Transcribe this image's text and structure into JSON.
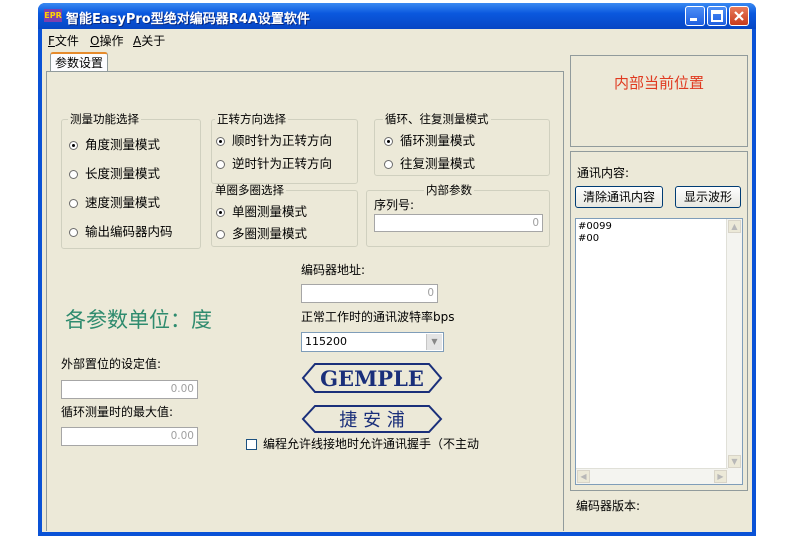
{
  "window": {
    "title": "智能EasyPro型绝对编码器R4A设置软件",
    "icon_text": "EPR",
    "icon": "app-logo-icon",
    "controls": [
      "minimize-icon",
      "maximize-icon",
      "close-icon"
    ]
  },
  "menu": [
    {
      "key": "F",
      "label": "文件"
    },
    {
      "key": "O",
      "label": "操作"
    },
    {
      "key": "A",
      "label": "关于"
    }
  ],
  "tab": {
    "label": "参数设置"
  },
  "groups": {
    "measure_mode": {
      "legend": "测量功能选择",
      "options": [
        "角度测量模式",
        "长度测量模式",
        "速度测量模式",
        "输出编码器内码"
      ],
      "selected": 0
    },
    "direction": {
      "legend": "正转方向选择",
      "options": [
        "顺时针为正转方向",
        "逆时针为正转方向"
      ],
      "selected": 0
    },
    "cycle_mode": {
      "legend": "循环、往复测量模式",
      "options": [
        "循环测量模式",
        "往复测量模式"
      ],
      "selected": 0
    },
    "turn_mode": {
      "legend": "单圈多圈选择",
      "options": [
        "单圈测量模式",
        "多圈测量模式"
      ],
      "selected": 0
    },
    "internal": {
      "legend": "内部参数",
      "serial_label": "序列号:",
      "serial_value": "0"
    }
  },
  "unit_text": "各参数单位：度",
  "address": {
    "label": "编码器地址:",
    "value": "0"
  },
  "baud": {
    "label": "正常工作时的通讯波特率bps",
    "value": "115200"
  },
  "preset": {
    "label": "外部置位的设定值:",
    "value": "0.00"
  },
  "max_value": {
    "label": "循环测量时的最大值:",
    "value": "0.00"
  },
  "logos": {
    "gemple": "GEMPLE",
    "chinese": "捷 安 浦"
  },
  "handshake": {
    "label": "编程允许线接地时允许通讯握手（不主动",
    "checked": false
  },
  "position": {
    "label": "内部当前位置"
  },
  "comm": {
    "label": "通讯内容:",
    "clear_button": "清除通讯内容",
    "wave_button": "显示波形",
    "lines": [
      "#0099",
      "#00"
    ]
  },
  "version": {
    "label": "编码器版本:"
  },
  "colors": {
    "titlebar": "#0a52d6",
    "position_text": "#e03a20",
    "unit_text": "#2e8b6e",
    "logo": "#1a2f7a"
  }
}
